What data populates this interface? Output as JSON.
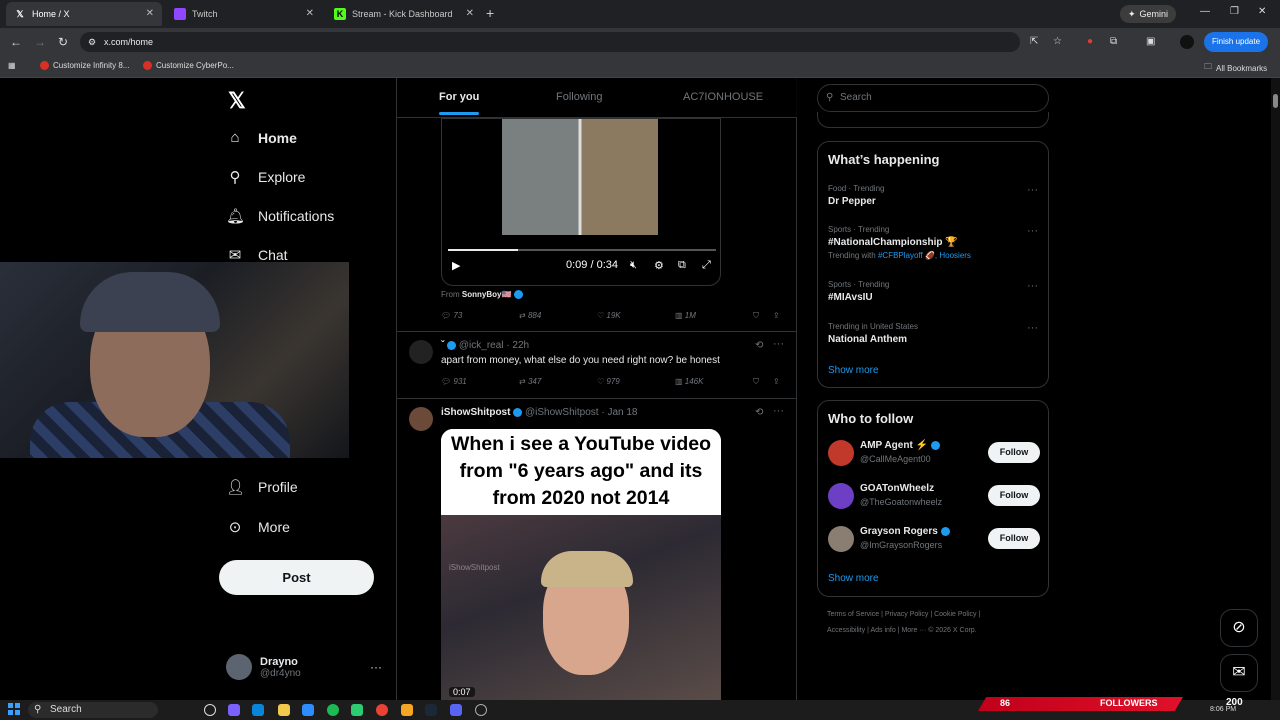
{
  "browser": {
    "tabs": [
      {
        "title": "Home / X",
        "icon": "x-logo-icon"
      },
      {
        "title": "Twitch",
        "icon": "twitch-icon"
      },
      {
        "title": "Stream - Kick Dashboard",
        "icon": "kick-icon"
      }
    ],
    "gemini_label": "Gemini",
    "url": "x.com/home",
    "finish_update": "Finish update",
    "bookmarks": [
      "Customize Infinity 8...",
      "Customize CyberPo..."
    ],
    "all_bookmarks": "All Bookmarks"
  },
  "sidebar": {
    "items": [
      {
        "label": "Home",
        "icon": "home-icon"
      },
      {
        "label": "Explore",
        "icon": "search-icon"
      },
      {
        "label": "Notifications",
        "icon": "bell-icon"
      },
      {
        "label": "Chat",
        "icon": "mail-icon"
      },
      {
        "label": "Profile",
        "icon": "person-icon"
      },
      {
        "label": "More",
        "icon": "more-circle-icon"
      }
    ],
    "post_button": "Post",
    "account": {
      "name": "Drayno",
      "handle": "@dr4yno"
    }
  },
  "feed": {
    "tabs": [
      "For you",
      "Following",
      "AC7IONHOUSE"
    ],
    "tweet1": {
      "video_time": "0:09 / 0:34",
      "progress": 0.26,
      "from_label": "From",
      "from_user": "SonnyBoy🇺🇸",
      "replies": "73",
      "reposts": "884",
      "likes": "19K",
      "views": "1M"
    },
    "tweet2": {
      "name": "ˇ",
      "handle": "@ick_real",
      "time": "22h",
      "text": "apart from money, what else do you need right now? be honest",
      "replies": "931",
      "reposts": "347",
      "likes": "979",
      "views": "146K"
    },
    "tweet3": {
      "name": "iShowShitpost",
      "handle": "@iShowShitpost",
      "time": "Jan 18",
      "caption": "When i see a YouTube video from \"6 years ago\" and its from 2020 not 2014",
      "watermark": "iShowShitpost",
      "duration": "0:07"
    }
  },
  "right": {
    "search_placeholder": "Search",
    "happening": {
      "title": "What’s happening",
      "trends": [
        {
          "category": "Food · Trending",
          "name": "Dr Pepper"
        },
        {
          "category": "Sports · Trending",
          "name": "#NationalChampionship 🏆",
          "with_label": "Trending with",
          "with_links": "#CFBPlayoff 🏈, Hoosiers"
        },
        {
          "category": "Sports · Trending",
          "name": "#MIAvsIU"
        },
        {
          "category": "Trending in United States",
          "name": "National Anthem"
        }
      ],
      "show_more": "Show more"
    },
    "who_to_follow": {
      "title": "Who to follow",
      "accounts": [
        {
          "name": "AMP Agent ⚡",
          "handle": "@CallMeAgent00",
          "avatar_color": "#c0392b"
        },
        {
          "name": "GOATonWheelz",
          "handle": "@TheGoatonwheelz",
          "avatar_color": "#6c3fc4"
        },
        {
          "name": "Grayson Rogers",
          "handle": "@ImGraysonRogers",
          "avatar_color": "#8a7e72"
        }
      ],
      "follow_label": "Follow",
      "show_more": "Show more"
    },
    "footer": {
      "line1": "Terms of Service  |  Privacy Policy  |  Cookie Policy  |",
      "line2": "Accessibility  |  Ads info  |  More ···   © 2026 X Corp."
    }
  },
  "taskbar": {
    "search": "Search",
    "followers_count": "86",
    "followers_label": "FOLLOWERS",
    "right_number": "200",
    "clock": "8:06 PM"
  },
  "colors": {
    "accent": "#1d9bf0",
    "background": "#000000",
    "followers_bar": "#d0001f"
  }
}
